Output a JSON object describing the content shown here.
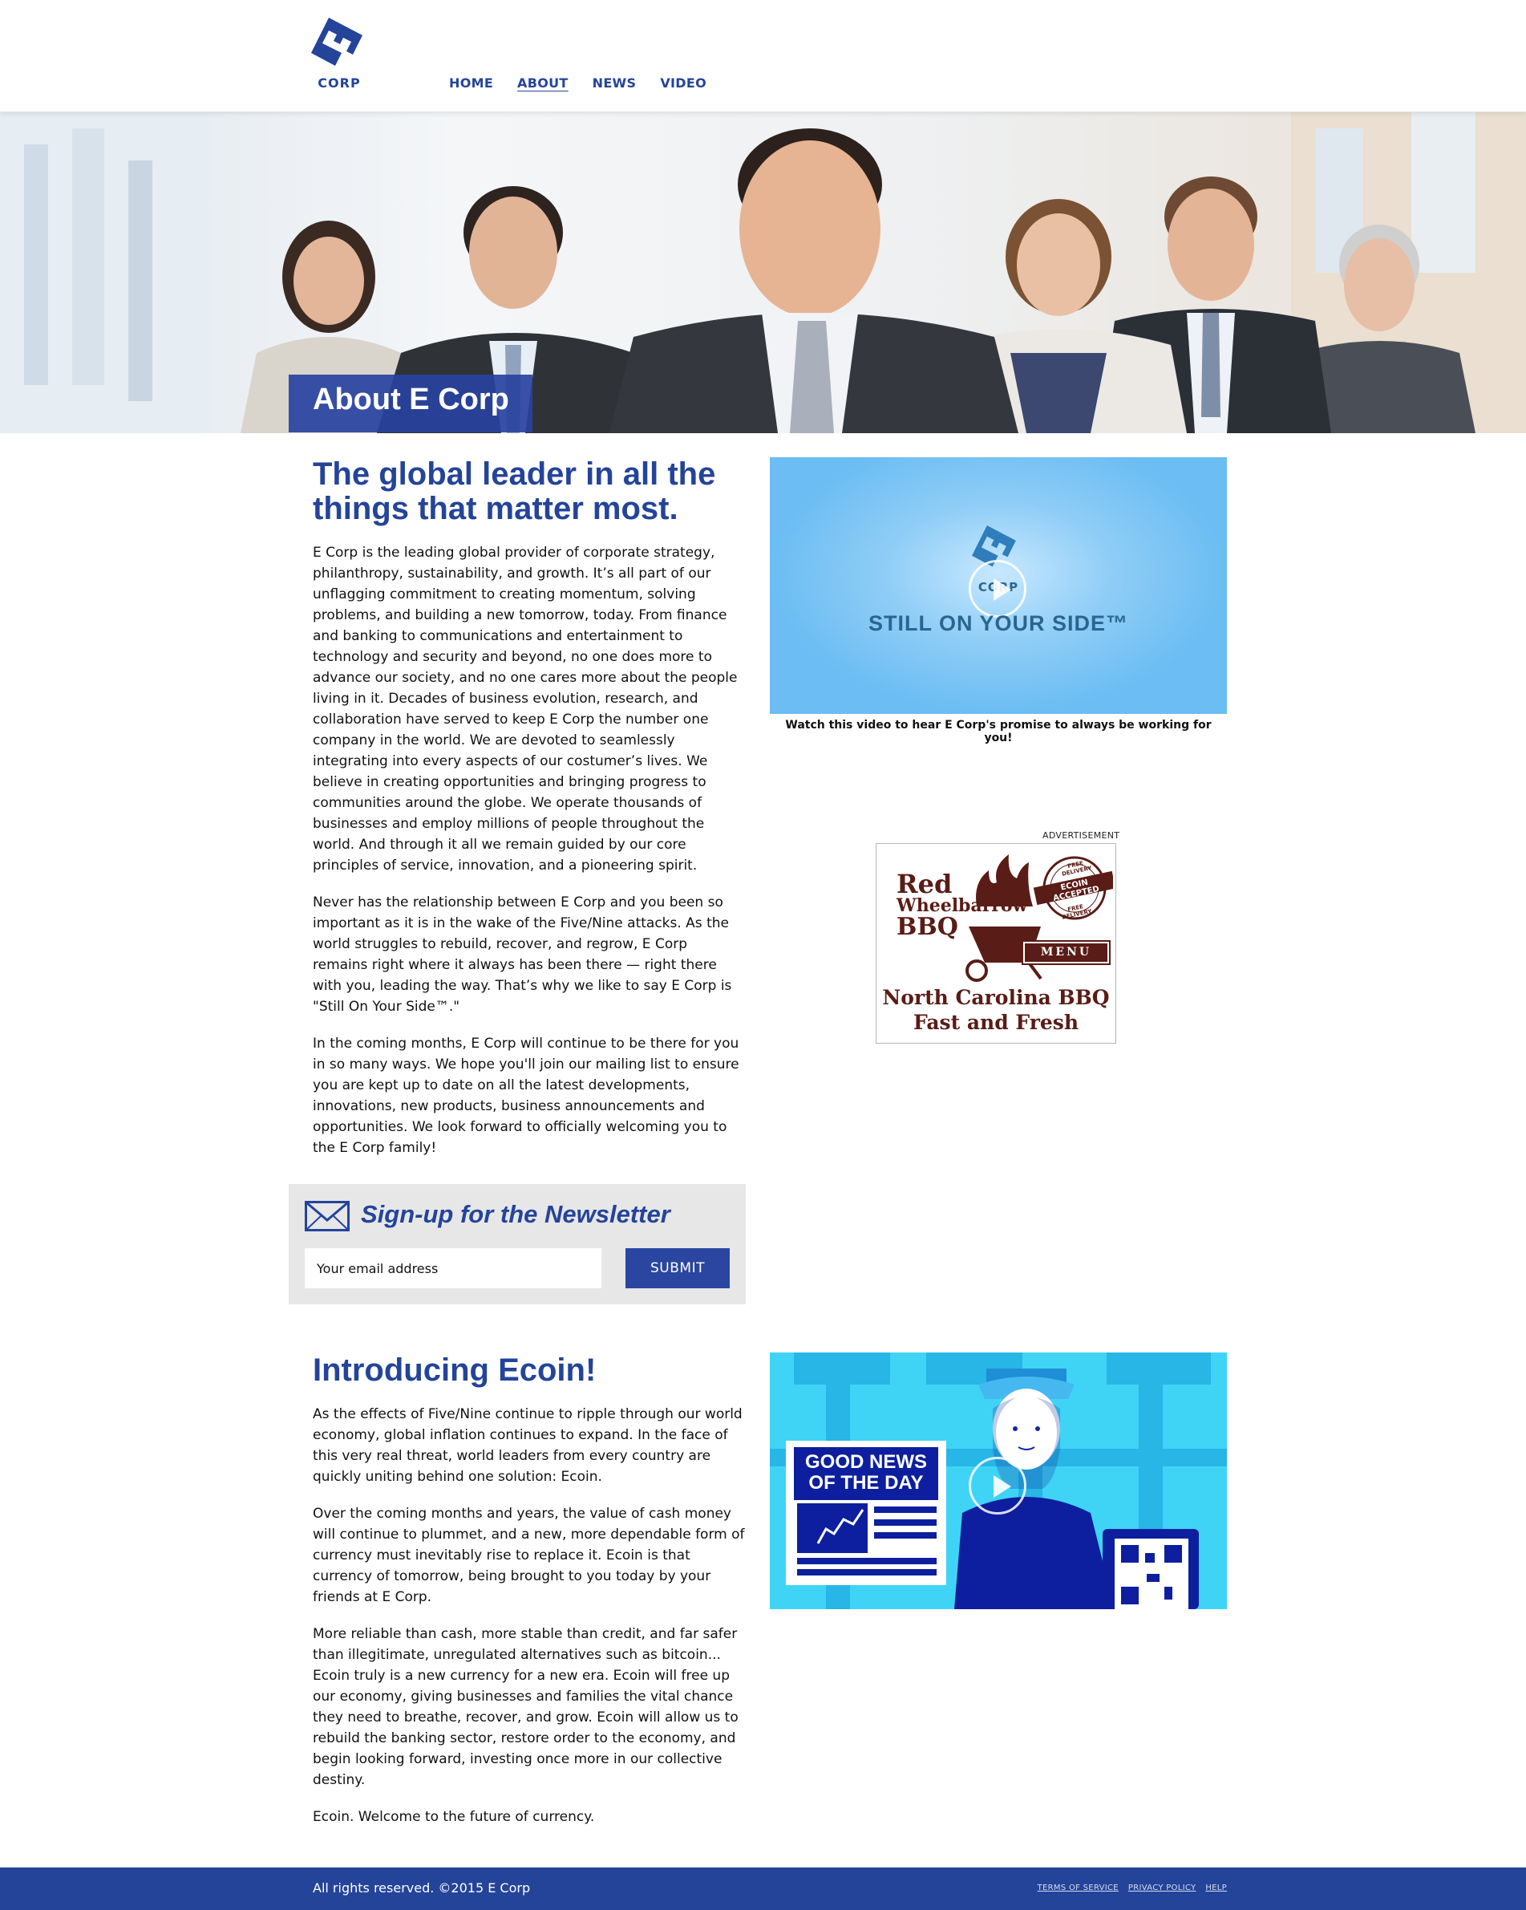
{
  "brand": {
    "logo_letter": "E",
    "logo_text": "CORP",
    "accent_color": "#24449a",
    "icon": "ecorp-logo-icon"
  },
  "nav": {
    "items": [
      {
        "label": "HOME"
      },
      {
        "label": "ABOUT"
      },
      {
        "label": "NEWS"
      },
      {
        "label": "VIDEO"
      }
    ],
    "active": "ABOUT"
  },
  "hero": {
    "title": "About E Corp"
  },
  "about": {
    "heading": "The global leader in all the things that matter most.",
    "paragraphs": [
      "E Corp is the leading global provider of corporate strategy, philanthropy, sustainability, and growth. It’s all part of our unflagging commitment to creating momentum, solving problems, and building a new tomorrow, today. From finance and banking to communications and entertainment to technology and security and beyond, no one does more to advance our society, and no one cares more about the people living in it. Decades of business evolution, research, and collaboration have served to keep E Corp the number one company in the world. We are devoted to seamlessly integrating into every aspects of our costumer’s lives. We believe in creating opportunities and bringing progress to communities around the globe. We operate thousands of businesses and employ millions of people throughout the world. And through it all we remain guided by our core principles of service, innovation, and a pioneering spirit.",
      "Never has the relationship between E Corp and you been so important as it is in the wake of the Five/Nine attacks. As the world struggles to rebuild, recover, and regrow, E Corp remains right where it always has been there — right there with you, leading the way. That’s why we like to say E Corp is \"Still On Your Side™.\"",
      "In the coming months, E Corp will continue to be there for you in so many ways. We hope you'll join our mailing list to ensure you are kept up to date on all the latest developments, innovations, new products, business announcements and opportunities. We look forward to officially welcoming you to the E Corp family!"
    ]
  },
  "video1": {
    "logo_text": "CORP",
    "tagline": "STILL ON YOUR SIDE™",
    "caption": "Watch this video to hear E Corp's promise to always be working for you!",
    "bg_color": "#6cbdf3"
  },
  "ad": {
    "label": "ADVERTISEMENT",
    "name_line1": "Red",
    "name_line2": "Wheelbarrow",
    "name_line3": "BBQ",
    "seal_top": "FREE DELIVERY",
    "seal_band": "ECOIN ACCEPTED",
    "seal_bottom": "FREE DELIVERY",
    "menu_label": "MENU",
    "slogan_line1": "North Carolina BBQ",
    "slogan_line2": "Fast and Fresh",
    "color": "#5a1c16"
  },
  "newsletter": {
    "title": "Sign-up for the Newsletter",
    "placeholder": "Your email address",
    "submit_label": "SUBMIT",
    "icon": "mail-icon"
  },
  "ecoin": {
    "heading": "Introducing Ecoin!",
    "paragraphs": [
      "As the effects of Five/Nine continue to ripple through our world economy, global inflation continues to expand. In the face of this very real threat, world leaders from every country are quickly uniting behind one solution: Ecoin.",
      "Over the coming months and years, the value of cash money will continue to plummet, and a new, more dependable form of currency must inevitably rise to replace it. Ecoin is that currency of tomorrow, being brought to you today by your friends at E Corp.",
      "More reliable than cash, more stable than credit, and far safer than illegitimate, unregulated alternatives such as bitcoin... Ecoin truly is a new currency for a new era. Ecoin will free up our economy, giving businesses and families the vital chance they need to breathe, recover, and grow. Ecoin will allow us to rebuild the banking sector, restore order to the economy, and begin looking forward, investing once more in our collective destiny.",
      "Ecoin. Welcome to the future of currency."
    ]
  },
  "video2": {
    "sign_line1": "GOOD NEWS",
    "sign_line2": "OF THE DAY",
    "bg_color": "#3fd4f5"
  },
  "footer": {
    "copyright": "All rights reserved. ©2015 E Corp",
    "links": [
      "TERMS OF SERVICE",
      "PRIVACY POLICY",
      "HELP"
    ]
  }
}
